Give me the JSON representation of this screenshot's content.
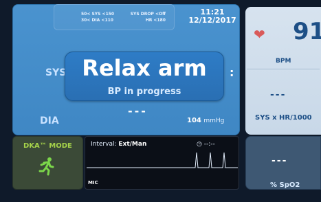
{
  "bp": {
    "alarm_limits": {
      "sys": "50< SYS <150",
      "dia": "30< DIA <110",
      "sys_drop": "SYS DROP <Off",
      "hr": "HR <180"
    },
    "time": "11:21",
    "date": "12/12/2017",
    "sys_label": "SYS",
    "dia_label": "DIA",
    "colon": ":",
    "map_value": "---",
    "pulse_value": "104",
    "pulse_unit": "mmHg",
    "message_title": "Relax arm",
    "message_subtitle": "BP in progress"
  },
  "hr": {
    "value": "91",
    "label": "BPM",
    "secondary_value": "---",
    "secondary_label": "SYS x HR/1000",
    "heart_icon": "heart-icon",
    "heart_color": "#d95a5a"
  },
  "dka": {
    "title": "DKA™ MODE",
    "icon": "running-person-icon",
    "icon_color": "#7bd64a"
  },
  "ecg": {
    "interval_label": "Interval:",
    "interval_value": "Ext/Man",
    "timer_value": "--:--",
    "timer_icon": "clock-icon",
    "lead_label": "MIC"
  },
  "spo2": {
    "value": "---",
    "label": "% SpO2"
  },
  "colors": {
    "bp_panel": "#4a93cf",
    "hr_panel": "#d7e3ef",
    "dka_accent": "#a6d34a"
  }
}
